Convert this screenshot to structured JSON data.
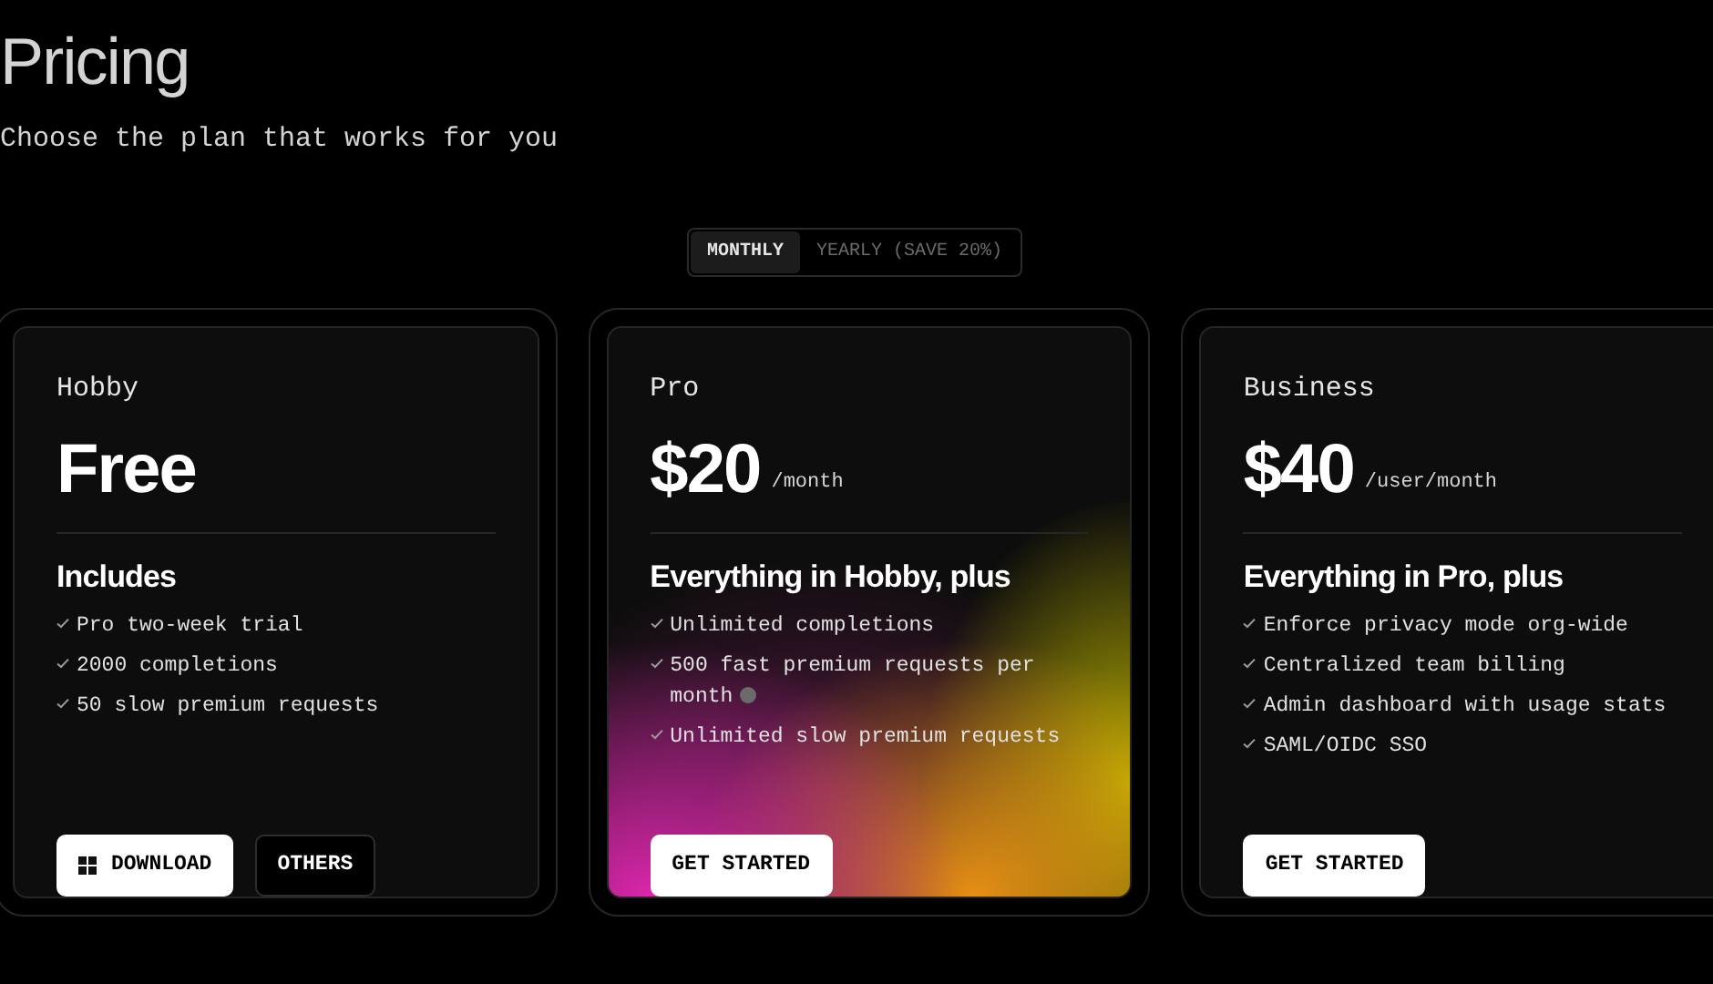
{
  "header": {
    "title": "Pricing",
    "subtitle": "Choose the plan that works for you"
  },
  "billing_tabs": [
    {
      "label": "MONTHLY",
      "selected": true
    },
    {
      "label": "YEARLY (SAVE 20%)",
      "selected": false
    }
  ],
  "plans": [
    {
      "name": "Hobby",
      "price": "Free",
      "highlight": false,
      "heading": "Includes",
      "features": [
        {
          "text": "Pro two-week trial",
          "info": false
        },
        {
          "text": "2000 completions",
          "info": false
        },
        {
          "text": "50 slow premium requests",
          "info": false
        }
      ],
      "buttons": [
        {
          "label": "DOWNLOAD",
          "kind": "download"
        },
        {
          "label": "OTHERS",
          "kind": "secondary"
        }
      ]
    },
    {
      "name": "Pro",
      "price": "$20",
      "unit": "/month",
      "highlight": true,
      "heading": "Everything in Hobby, plus",
      "features": [
        {
          "text": "Unlimited completions",
          "info": false
        },
        {
          "text": "500 fast premium requests per month",
          "info": true
        },
        {
          "text": "Unlimited slow premium requests",
          "info": false
        }
      ],
      "buttons": [
        {
          "label": "GET STARTED",
          "kind": "primary"
        }
      ]
    },
    {
      "name": "Business",
      "price": "$40",
      "unit": "/user/month",
      "highlight": false,
      "heading": "Everything in Pro, plus",
      "features": [
        {
          "text": "Enforce privacy mode org-wide",
          "info": false
        },
        {
          "text": "Centralized team billing",
          "info": false
        },
        {
          "text": "Admin dashboard with usage stats",
          "info": false
        },
        {
          "text": "SAML/OIDC SSO",
          "info": false
        }
      ],
      "buttons": [
        {
          "label": "GET STARTED",
          "kind": "primary"
        }
      ]
    }
  ]
}
